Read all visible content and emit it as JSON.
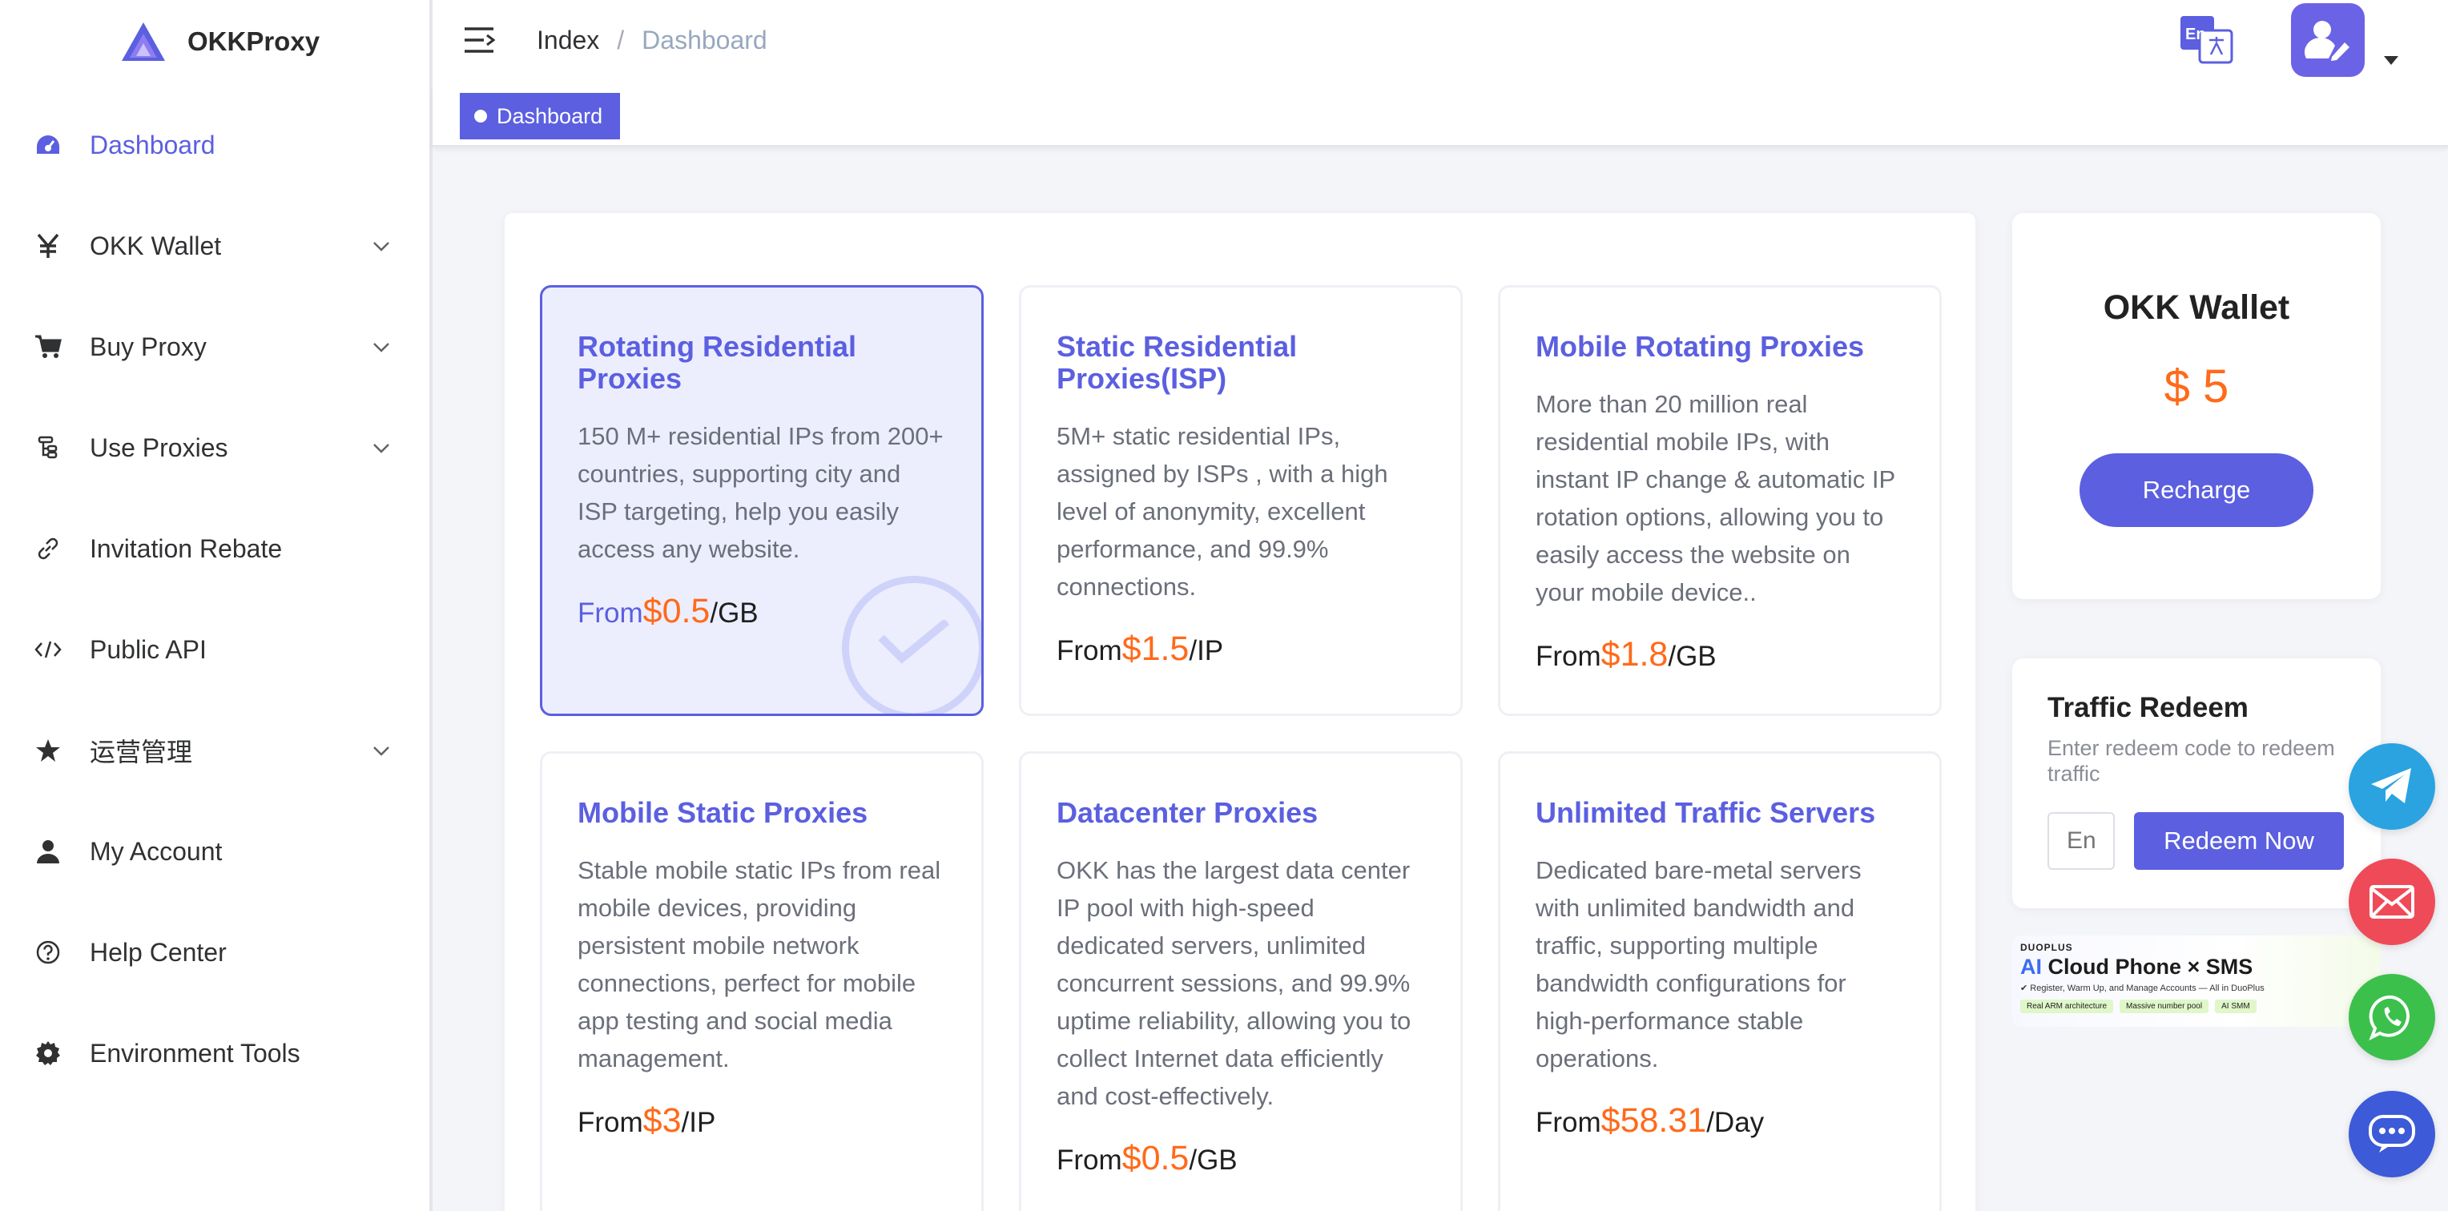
{
  "brand": {
    "name": "OKKProxy"
  },
  "sidebar": {
    "items": [
      {
        "label": "Dashboard",
        "icon": "dashboard-icon",
        "active": true,
        "expandable": false
      },
      {
        "label": "OKK Wallet",
        "icon": "yen-icon",
        "active": false,
        "expandable": true
      },
      {
        "label": "Buy Proxy",
        "icon": "cart-icon",
        "active": false,
        "expandable": true
      },
      {
        "label": "Use Proxies",
        "icon": "tree-icon",
        "active": false,
        "expandable": true
      },
      {
        "label": "Invitation Rebate",
        "icon": "link-icon",
        "active": false,
        "expandable": false
      },
      {
        "label": "Public API",
        "icon": "code-icon",
        "active": false,
        "expandable": false
      },
      {
        "label": "运营管理",
        "icon": "star-icon",
        "active": false,
        "expandable": true
      },
      {
        "label": "My Account",
        "icon": "user-icon",
        "active": false,
        "expandable": false
      },
      {
        "label": "Help Center",
        "icon": "help-icon",
        "active": false,
        "expandable": false
      },
      {
        "label": "Environment Tools",
        "icon": "gear-icon",
        "active": false,
        "expandable": false
      }
    ]
  },
  "header": {
    "breadcrumb": [
      "Index",
      "/",
      "Dashboard"
    ],
    "lang_icon_text": "En",
    "tag": "Dashboard"
  },
  "products": [
    {
      "title": "Rotating Residential Proxies",
      "desc": "150 M+ residential IPs from 200+ countries, supporting city and ISP targeting, help you easily access any website.",
      "from": "From",
      "price": "$0.5",
      "unit": "/GB",
      "selected": true
    },
    {
      "title": "Static Residential Proxies(ISP)",
      "desc": "5M+ static residential IPs, assigned by ISPs , with a high level of anonymity, excellent performance, and 99.9% connections.",
      "from": "From",
      "price": "$1.5",
      "unit": "/IP",
      "selected": false
    },
    {
      "title": "Mobile Rotating Proxies",
      "desc": "More than 20 million real residential mobile IPs, with instant IP change & automatic IP rotation options, allowing you to easily access the website on your mobile device..",
      "from": "From",
      "price": "$1.8",
      "unit": "/GB",
      "selected": false
    },
    {
      "title": "Mobile Static Proxies",
      "desc": "Stable mobile static IPs from real mobile devices, providing persistent mobile network connections, perfect for mobile app testing and social media management.",
      "from": "From",
      "price": "$3",
      "unit": "/IP",
      "selected": false
    },
    {
      "title": "Datacenter Proxies",
      "desc": "OKK has the largest data center IP pool with high-speed dedicated servers, unlimited concurrent sessions, and 99.9% uptime reliability, allowing you to collect Internet data efficiently and cost-effectively.",
      "from": "From",
      "price": "$0.5",
      "unit": "/GB",
      "selected": false
    },
    {
      "title": "Unlimited Traffic Servers",
      "desc": "Dedicated bare-metal servers with unlimited bandwidth and traffic, supporting multiple bandwidth configurations for high-performance stable operations.",
      "from": "From",
      "price": "$58.31",
      "unit": "/Day",
      "selected": false
    }
  ],
  "wallet": {
    "title": "OKK Wallet",
    "amount": "$ 5",
    "recharge_label": "Recharge"
  },
  "redeem": {
    "title": "Traffic Redeem",
    "subtitle": "Enter redeem code to redeem traffic",
    "placeholder": "En",
    "button_label": "Redeem Now"
  },
  "banner": {
    "brand": "DUOPLUS",
    "ai": "AI",
    "headline": "Cloud Phone × SMS",
    "sub": "✔ Register, Warm Up, and Manage Accounts — All in DuoPlus",
    "chips": [
      "Real ARM architecture",
      "Massive number pool",
      "AI SMM"
    ]
  },
  "fabs": [
    "telegram-icon",
    "mail-icon",
    "whatsapp-icon",
    "chat-icon"
  ],
  "colors": {
    "accent": "#5b5fe0",
    "price": "#ff6a1a"
  }
}
